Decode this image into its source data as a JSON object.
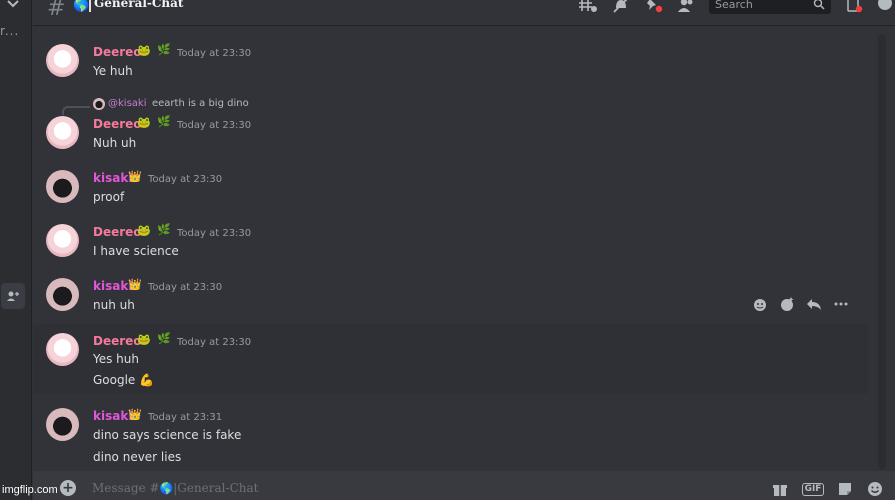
{
  "header": {
    "channel_prefix": "#",
    "channel_globe": "🌎",
    "title": "General-Chat",
    "search_placeholder": "Search"
  },
  "left": {
    "truncated_text": "r..."
  },
  "messages": [
    {
      "author": "Deereo",
      "badges": [
        "🐸",
        "🌿"
      ],
      "time": "Today at 23:30",
      "lines": [
        "Ye huh"
      ]
    },
    {
      "author": "Deereo",
      "badges": [
        "🐸",
        "🌿"
      ],
      "time": "Today at 23:30",
      "lines": [
        "Nuh uh"
      ],
      "reply": {
        "name": "@kisaki",
        "text": "eearth is a big dino"
      }
    },
    {
      "author": "kisaki",
      "badges": [
        "👑"
      ],
      "time": "Today at 23:30",
      "lines": [
        "proof"
      ]
    },
    {
      "author": "Deereo",
      "badges": [
        "🐸",
        "🌿"
      ],
      "time": "Today at 23:30",
      "lines": [
        "I have science"
      ]
    },
    {
      "author": "kisaki",
      "badges": [
        "👑"
      ],
      "time": "Today at 23:30",
      "lines": [
        "nuh uh"
      ]
    },
    {
      "author": "Deereo",
      "badges": [
        "🐸",
        "🌿"
      ],
      "time": "Today at 23:30",
      "lines": [
        "Yes huh",
        "Google 💪"
      ]
    },
    {
      "author": "kisaki",
      "badges": [
        "👑"
      ],
      "time": "Today at 23:31",
      "lines": [
        "dino says science is fake",
        "dino never lies"
      ]
    }
  ],
  "composer": {
    "placeholder_prefix": "Message #",
    "placeholder_globe": "🌎",
    "placeholder_channel": "General-Chat",
    "gif_label": "GIF"
  },
  "watermark": "imgflip.com",
  "colors": {
    "background": "#313338",
    "deereo_name": "#f47b9a",
    "kisaki_name": "#e256d8",
    "timestamp": "#949ba4"
  }
}
